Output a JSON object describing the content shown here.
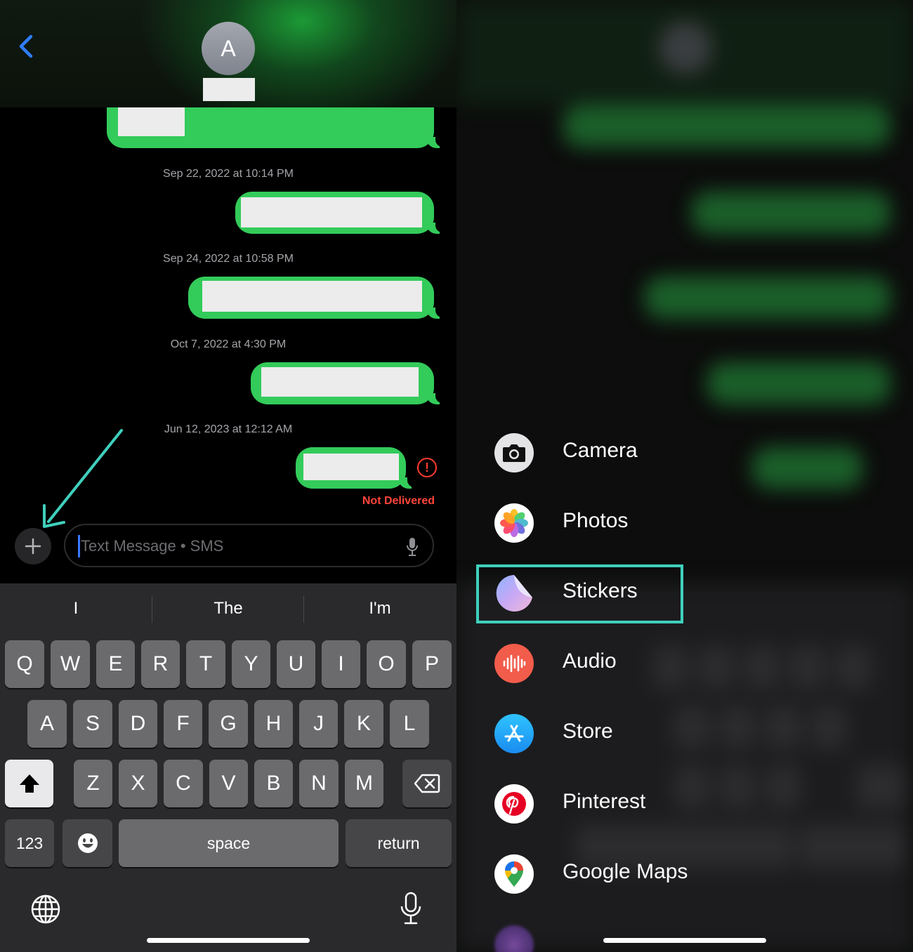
{
  "header": {
    "avatar_initial": "A"
  },
  "timestamps": [
    "Sep 22, 2022 at 10:14 PM",
    "Sep 24, 2022 at 10:58 PM",
    "Oct 7, 2022 at 4:30 PM",
    "Jun 12, 2023 at 12:12 AM"
  ],
  "status": {
    "failed_icon": "!",
    "not_delivered": "Not Delivered"
  },
  "composer": {
    "placeholder": "Text Message • SMS",
    "value": ""
  },
  "keyboard": {
    "suggestions": [
      "I",
      "The",
      "I'm"
    ],
    "row1": [
      "Q",
      "W",
      "E",
      "R",
      "T",
      "Y",
      "U",
      "I",
      "O",
      "P"
    ],
    "row2": [
      "A",
      "S",
      "D",
      "F",
      "G",
      "H",
      "J",
      "K",
      "L"
    ],
    "row3": [
      "Z",
      "X",
      "C",
      "V",
      "B",
      "N",
      "M"
    ],
    "numbers_key": "123",
    "space_key": "space",
    "return_key": "return"
  },
  "apps_menu": {
    "items": [
      "Camera",
      "Photos",
      "Stickers",
      "Audio",
      "Store",
      "Pinterest",
      "Google Maps"
    ],
    "highlighted": "Stickers"
  },
  "colors": {
    "bubble_green": "#33cb5a",
    "annotation_teal": "#3fd0bd",
    "error_red": "#ff3b30",
    "ios_blue": "#3a78ff"
  }
}
